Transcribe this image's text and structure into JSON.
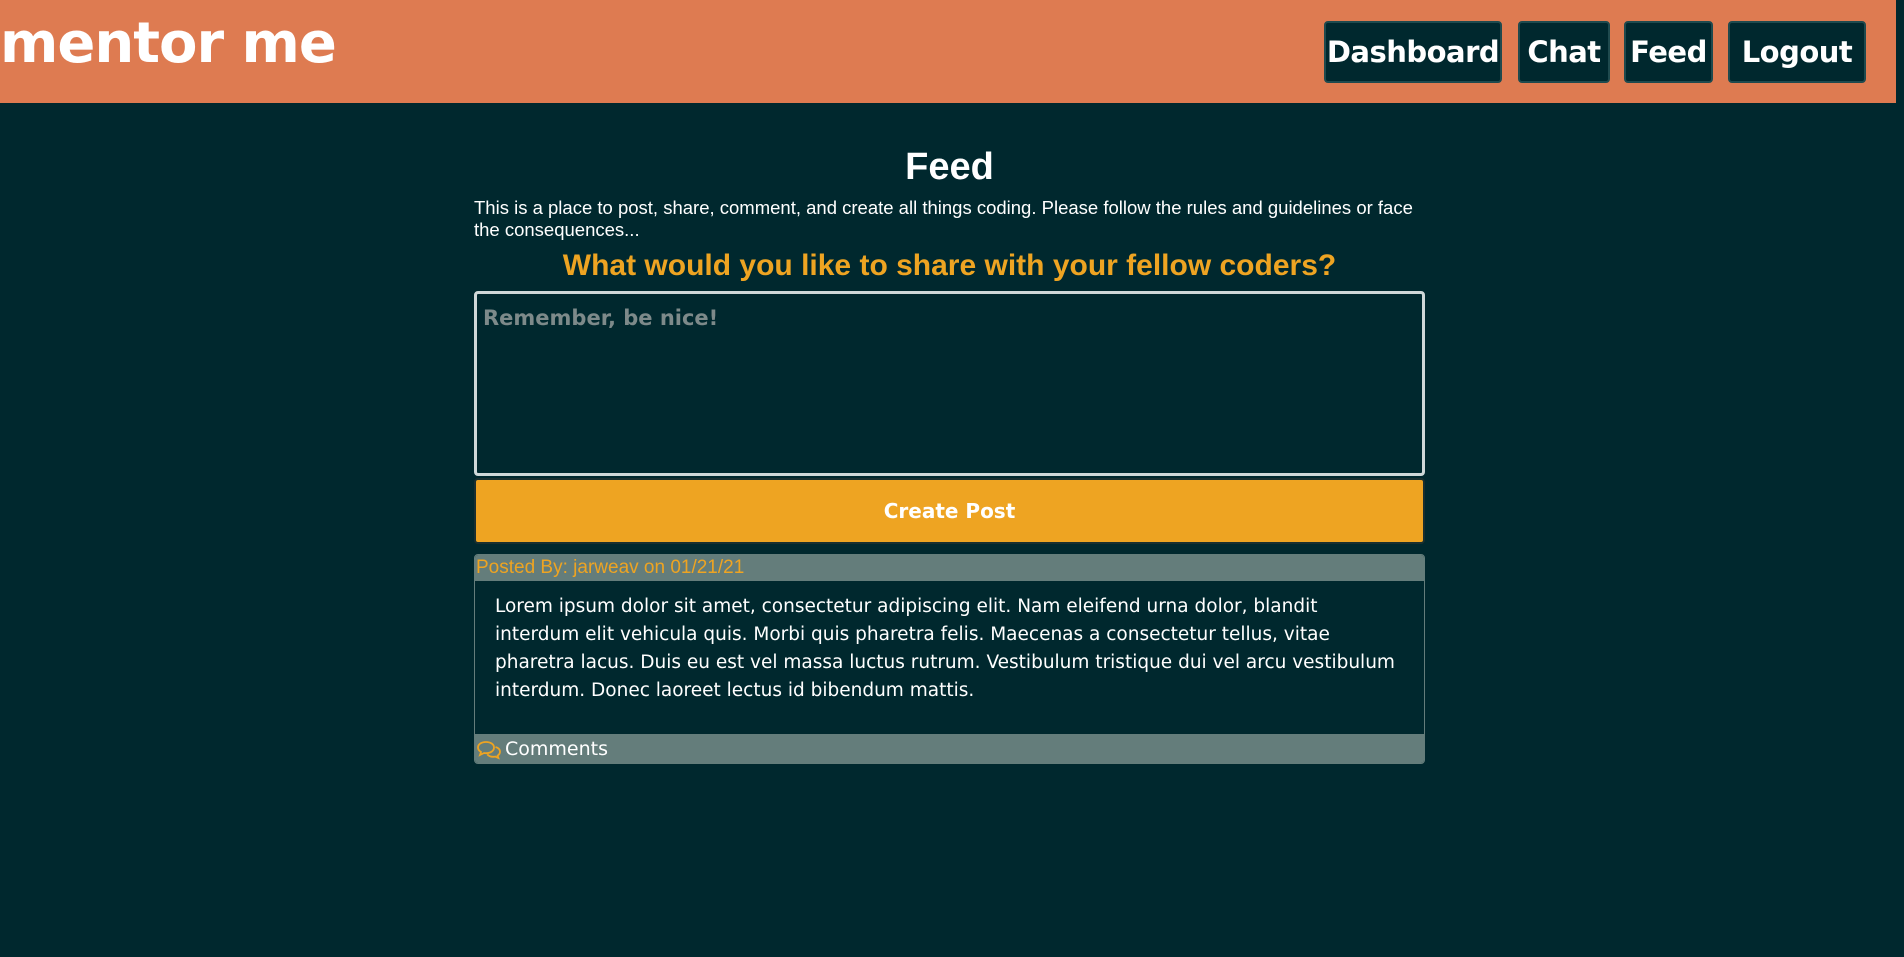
{
  "header": {
    "logo": "mentor me",
    "nav": {
      "dashboard": "Dashboard",
      "chat": "Chat",
      "feed": "Feed",
      "logout": "Logout"
    }
  },
  "main": {
    "title": "Feed",
    "intro": "This is a place to post, share, comment, and create all things coding. Please follow the rules and guidelines or face the consequences...",
    "prompt": "What would you like to share with your fellow coders?",
    "post_input": {
      "placeholder": "Remember, be nice!",
      "value": ""
    },
    "create_button": "Create Post"
  },
  "posts": [
    {
      "meta": "Posted By: jarweav on 01/21/21",
      "body": "Lorem ipsum dolor sit amet, consectetur adipiscing elit. Nam eleifend urna dolor, blandit interdum elit vehicula quis. Morbi quis pharetra felis. Maecenas a consectetur tellus, vitae pharetra lacus. Duis eu est vel massa luctus rutrum. Vestibulum tristique dui vel arcu vestibulum interdum. Donec laoreet lectus id bibendum mattis.",
      "comments_label": "Comments"
    }
  ],
  "icons": {
    "comments": "comments-icon"
  },
  "colors": {
    "header_bg": "#de7b51",
    "page_bg": "#00282e",
    "accent": "#eea422",
    "card_bar": "#647d7b"
  }
}
